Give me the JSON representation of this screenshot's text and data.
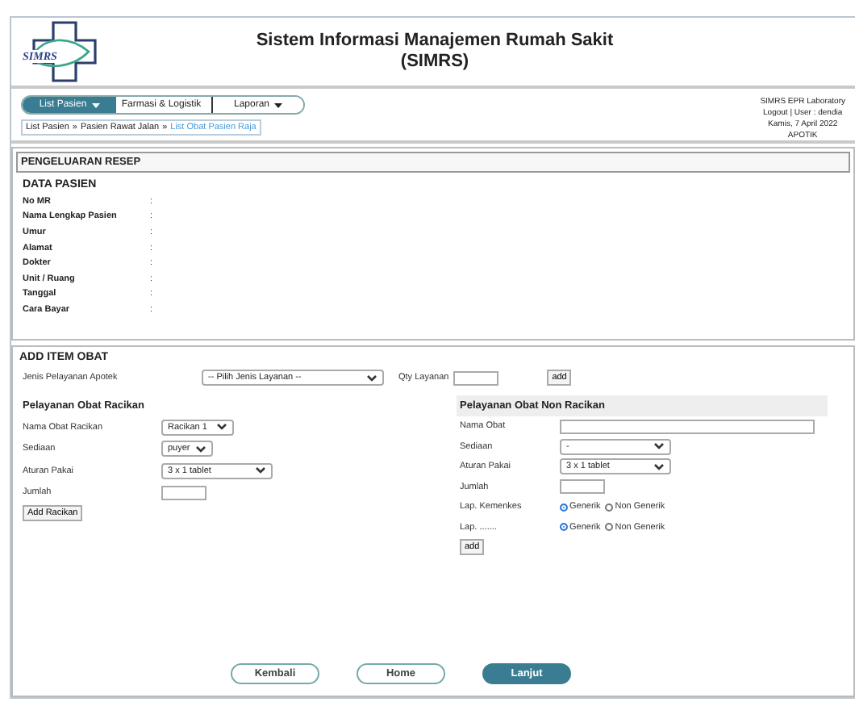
{
  "header": {
    "logo_text": "SIMRS",
    "title_lines": [
      "Sistem Informasi Manajemen Rumah Sakit",
      "(SIMRS)"
    ]
  },
  "menu": [
    {
      "label": "List Pasien",
      "selected": true
    },
    {
      "label": "Farmasi & Logistik",
      "selected": false
    },
    {
      "label": "Laporan",
      "selected": false
    }
  ],
  "breadcrumb": [
    {
      "label": "List Pasien",
      "kind": "text"
    },
    {
      "label": "»",
      "kind": "sep"
    },
    {
      "label": "Pasien Rawat Jalan",
      "kind": "text"
    },
    {
      "label": "»",
      "kind": "sep"
    },
    {
      "label": "List Obat Pasien Raja",
      "kind": "link"
    }
  ],
  "user_info": [
    "SIMRS EPR Laboratory",
    "Logout | User : dendia",
    "Kamis, 7 April 2022",
    "APOTIK"
  ],
  "resep_panel": {
    "title": "PENGELUARAN RESEP",
    "section": "DATA PASIEN",
    "fields": [
      {
        "label": "No MR",
        "separator": ":"
      },
      {
        "label": "Nama Lengkap Pasien",
        "separator": ":"
      },
      {
        "label": "Umur",
        "separator": ":"
      },
      {
        "label": "Alamat",
        "separator": ":"
      },
      {
        "label": "Dokter",
        "separator": ":"
      },
      {
        "label": "Unit / Ruang",
        "separator": ":"
      },
      {
        "label": "Tanggal",
        "separator": ":"
      },
      {
        "label": "Cara Bayar",
        "separator": ":"
      }
    ]
  },
  "add_item": {
    "title": "ADD ITEM OBAT",
    "service": {
      "label": "Jenis Pelayanan Apotek",
      "select": "-- Pilih Jenis Layanan --",
      "qty_label": "Qty Layanan",
      "button": "add"
    },
    "racikan": {
      "title": "Pelayanan Obat Racikan",
      "rows": [
        {
          "label": "Nama Obat Racikan",
          "kind": "select",
          "value": "Racikan 1"
        },
        {
          "label": "Sediaan",
          "kind": "select",
          "value": "puyer"
        },
        {
          "label": "Aturan Pakai",
          "kind": "select",
          "value": "3 x 1 tablet"
        },
        {
          "label": "Jumlah",
          "kind": "input"
        }
      ],
      "button": "Add Racikan"
    },
    "non_racikan": {
      "title": "Pelayanan Obat Non Racikan",
      "rows": [
        {
          "label": "Nama Obat",
          "kind": "input"
        },
        {
          "label": "Sediaan",
          "kind": "select",
          "value": "-"
        },
        {
          "label": "Aturan Pakai",
          "kind": "select",
          "value": "3 x 1 tablet"
        },
        {
          "label": "Jumlah",
          "kind": "input"
        },
        {
          "label": "Lap. Kemenkes",
          "kind": "radio",
          "options": [
            {
              "label": "Generik",
              "selected": true
            },
            {
              "label": "Non Generik",
              "selected": false
            }
          ]
        },
        {
          "label": "Lap. .......",
          "kind": "radio",
          "options": [
            {
              "label": "Generik",
              "selected": true
            },
            {
              "label": "Non Generik",
              "selected": false
            }
          ]
        }
      ],
      "button": "add"
    }
  },
  "footer_buttons": [
    {
      "label": "Kembali",
      "primary": false
    },
    {
      "label": "Home",
      "primary": false
    },
    {
      "label": "Lanjut",
      "primary": true
    }
  ]
}
